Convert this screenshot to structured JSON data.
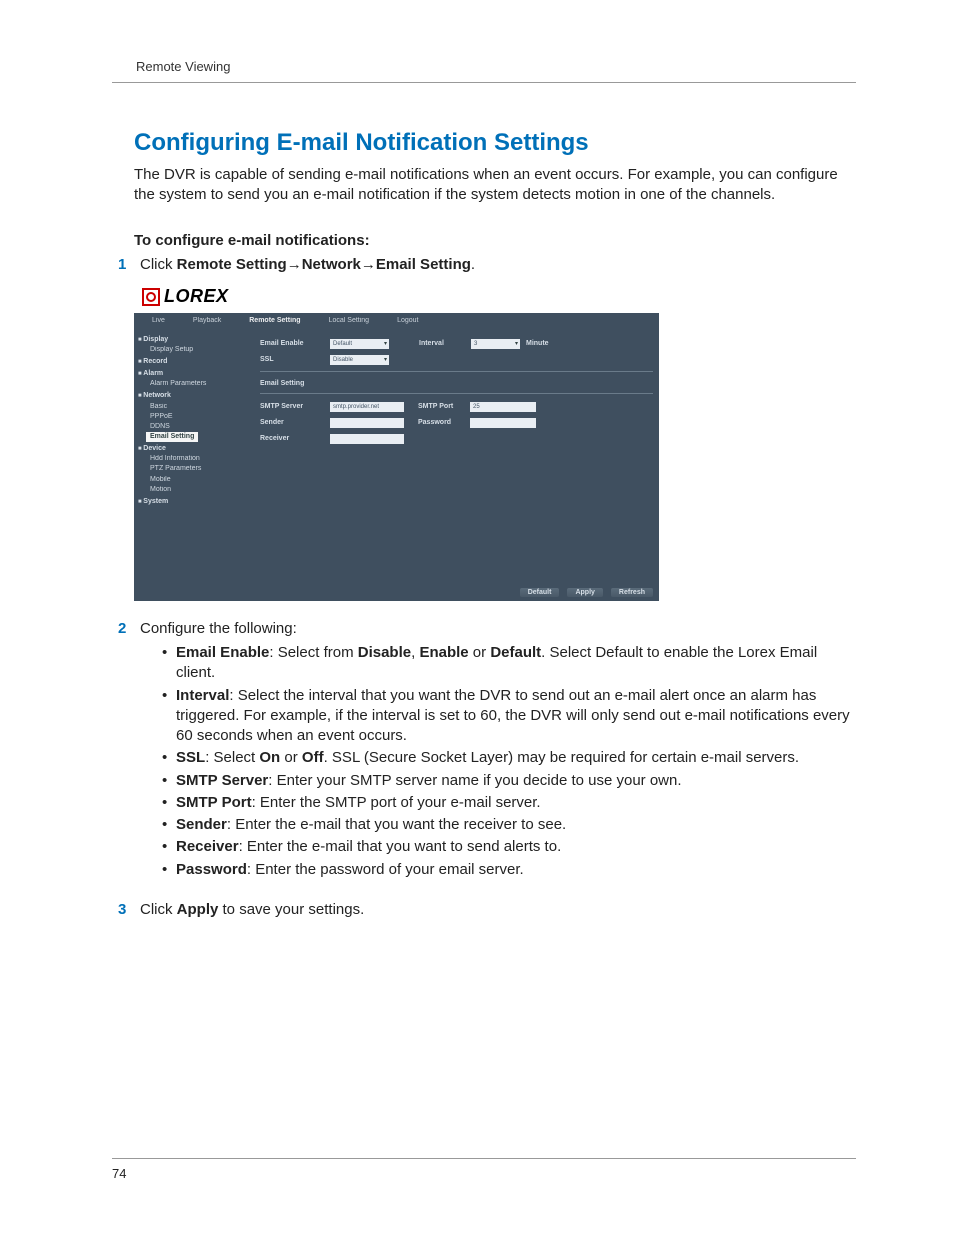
{
  "header": "Remote Viewing",
  "title": "Configuring E-mail Notification Settings",
  "intro": "The DVR is capable of sending e-mail notifications when an event occurs. For example, you can configure the system to send you an e-mail notification if the system detects motion in one of the channels.",
  "subhead": "To configure e-mail notifications:",
  "step1": {
    "num": "1",
    "pre": "Click ",
    "b1": "Remote Setting",
    "arrow": ">",
    "b2": "Network",
    "b3": "Email Setting",
    "post": "."
  },
  "screenshot": {
    "logo": "LOREX",
    "tabs": [
      "Live",
      "Playback",
      "Remote Setting",
      "Local Setting",
      "Logout"
    ],
    "sidebar": {
      "cats": [
        {
          "cat": "Display",
          "items": [
            "Display Setup"
          ]
        },
        {
          "cat": "Record",
          "items": []
        },
        {
          "cat": "Alarm",
          "items": [
            "Alarm Parameters"
          ]
        },
        {
          "cat": "Network",
          "items": [
            "Basic",
            "PPPoE",
            "DDNS",
            "Email Setting"
          ]
        },
        {
          "cat": "Device",
          "items": [
            "Hdd Information",
            "PTZ Parameters",
            "Mobile",
            "Motion"
          ]
        },
        {
          "cat": "System",
          "items": []
        }
      ],
      "selected": "Email Setting"
    },
    "form": {
      "email_enable_label": "Email Enable",
      "email_enable_value": "Default",
      "interval_label": "Interval",
      "interval_value": "3",
      "interval_unit": "Minute",
      "ssl_label": "SSL",
      "ssl_value": "Disable",
      "section": "Email Setting",
      "smtp_server_label": "SMTP Server",
      "smtp_server_value": "smtp.provider.net",
      "smtp_port_label": "SMTP Port",
      "smtp_port_value": "25",
      "sender_label": "Sender",
      "password_label": "Password",
      "receiver_label": "Receiver"
    },
    "footer_buttons": [
      "Default",
      "Apply",
      "Refresh"
    ]
  },
  "step2": {
    "num": "2",
    "text": "Configure the following:",
    "bullets": [
      {
        "b": "Email Enable",
        "t1": ": Select from ",
        "b2": "Disable",
        "t2": ", ",
        "b3": "Enable",
        "t3": " or ",
        "b4": "Default",
        "t4": ". Select Default to enable the Lorex Email client."
      },
      {
        "b": "Interval",
        "t1": ": Select the interval that you want the DVR to send out an e-mail alert once an alarm has triggered. For example, if the interval is set to 60, the DVR will only send out e-mail notifications every 60 seconds when an event occurs."
      },
      {
        "b": "SSL",
        "t1": ": Select ",
        "b2": "On",
        "t2": " or ",
        "b3": "Off",
        "t3": ". SSL (Secure Socket Layer) may be required for certain e-mail servers."
      },
      {
        "b": "SMTP Server",
        "t1": ": Enter your SMTP server name if you decide to use your own."
      },
      {
        "b": "SMTP Port",
        "t1": ": Enter the SMTP port of your e-mail server."
      },
      {
        "b": "Sender",
        "t1": ": Enter the e-mail that you want the receiver to see."
      },
      {
        "b": "Receiver",
        "t1": ": Enter the e-mail that you want to send alerts to."
      },
      {
        "b": "Password",
        "t1": ": Enter the password of your email server."
      }
    ]
  },
  "step3": {
    "num": "3",
    "pre": "Click ",
    "b": "Apply",
    "post": " to save your settings."
  },
  "page_number": "74"
}
